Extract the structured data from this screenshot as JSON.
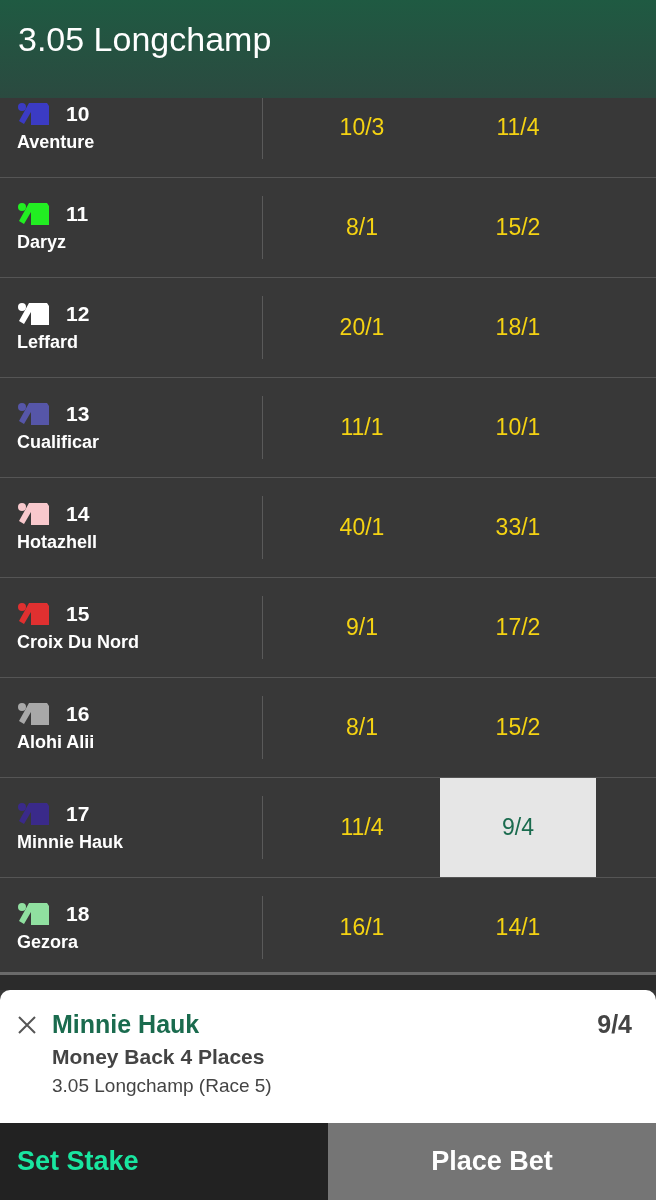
{
  "header": {
    "title": "3.05 Longchamp"
  },
  "runners": [
    {
      "number": "10",
      "name": "Aventure",
      "color": "#3b3bc4",
      "odds": [
        {
          "price": "10/3",
          "selected": false
        },
        {
          "price": "11/4",
          "selected": false
        }
      ]
    },
    {
      "number": "11",
      "name": "Daryz",
      "color": "#22ee22",
      "odds": [
        {
          "price": "8/1",
          "selected": false
        },
        {
          "price": "15/2",
          "selected": false
        }
      ]
    },
    {
      "number": "12",
      "name": "Leffard",
      "color": "#ffffff",
      "odds": [
        {
          "price": "20/1",
          "selected": false
        },
        {
          "price": "18/1",
          "selected": false
        }
      ]
    },
    {
      "number": "13",
      "name": "Cualificar",
      "color": "#5656a8",
      "odds": [
        {
          "price": "11/1",
          "selected": false
        },
        {
          "price": "10/1",
          "selected": false
        }
      ]
    },
    {
      "number": "14",
      "name": "Hotazhell",
      "color": "#f8c8cc",
      "odds": [
        {
          "price": "40/1",
          "selected": false
        },
        {
          "price": "33/1",
          "selected": false
        }
      ]
    },
    {
      "number": "15",
      "name": "Croix Du Nord",
      "color": "#e03030",
      "odds": [
        {
          "price": "9/1",
          "selected": false
        },
        {
          "price": "17/2",
          "selected": false
        }
      ]
    },
    {
      "number": "16",
      "name": "Alohi Alii",
      "color": "#a8a8a8",
      "odds": [
        {
          "price": "8/1",
          "selected": false
        },
        {
          "price": "15/2",
          "selected": false
        }
      ]
    },
    {
      "number": "17",
      "name": "Minnie Hauk",
      "color": "#3a2a8a",
      "odds": [
        {
          "price": "11/4",
          "selected": false
        },
        {
          "price": "9/4",
          "selected": true
        }
      ]
    },
    {
      "number": "18",
      "name": "Gezora",
      "color": "#90e0a0",
      "odds": [
        {
          "price": "16/1",
          "selected": false
        },
        {
          "price": "14/1",
          "selected": false
        }
      ]
    }
  ],
  "betslip": {
    "selection": "Minnie Hauk",
    "price": "9/4",
    "market": "Money Back 4 Places",
    "event": "3.05 Longchamp (Race 5)"
  },
  "actions": {
    "stake": "Set Stake",
    "place": "Place Bet"
  }
}
